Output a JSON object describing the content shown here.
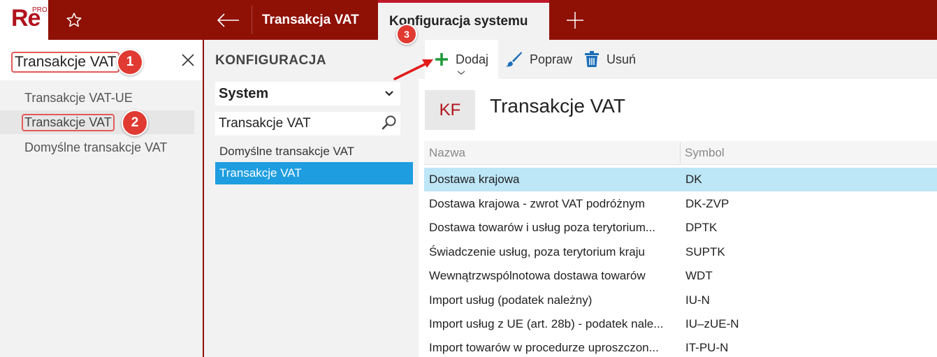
{
  "app": {
    "logo_text": "Re",
    "logo_sup": "PRO",
    "tabs": [
      {
        "label": "Transakcja VAT"
      },
      {
        "label": "Konfiguracja systemu"
      }
    ]
  },
  "left": {
    "search_value": "Transakcje VAT",
    "items": [
      {
        "label": "Transakcje VAT-UE"
      },
      {
        "label": "Transakcje VAT"
      },
      {
        "label": "Domyślne transakcje VAT"
      }
    ]
  },
  "config": {
    "title": "KONFIGURACJA",
    "select_value": "System",
    "search_value": "Transakcje VAT",
    "items": [
      {
        "label": "Domyślne transakcje VAT"
      },
      {
        "label": "Transakcje VAT"
      }
    ]
  },
  "toolbar": {
    "add_label": "Dodaj",
    "edit_label": "Popraw",
    "delete_label": "Usuń"
  },
  "content": {
    "badge": "KF",
    "title": "Transakcje VAT",
    "columns": [
      "Nazwa",
      "Symbol"
    ],
    "rows": [
      {
        "name": "Dostawa krajowa",
        "symbol": "DK"
      },
      {
        "name": "Dostawa krajowa - zwrot VAT podróżnym",
        "symbol": "DK-ZVP"
      },
      {
        "name": "Dostawa towarów i usług poza terytorium...",
        "symbol": "DPTK"
      },
      {
        "name": "Świadczenie usług, poza terytorium kraju",
        "symbol": "SUPTK"
      },
      {
        "name": "Wewnątrzwspólnotowa dostawa towarów",
        "symbol": "WDT"
      },
      {
        "name": "Import usług (podatek należny)",
        "symbol": "IU-N"
      },
      {
        "name": "Import usług z UE (art. 28b) - podatek nale...",
        "symbol": "IU–zUE-N"
      },
      {
        "name": "Import towarów w procedurze uproszczon...",
        "symbol": "IT-PU-N"
      }
    ]
  },
  "callouts": [
    "1",
    "2",
    "3"
  ],
  "colors": {
    "brand": "#8f1005",
    "accent_red": "#b0121c",
    "selection_blue": "#1e9ee0",
    "row_highlight": "#bde6f7",
    "add_green": "#1f9a3a",
    "icon_blue": "#1b6fb8"
  }
}
